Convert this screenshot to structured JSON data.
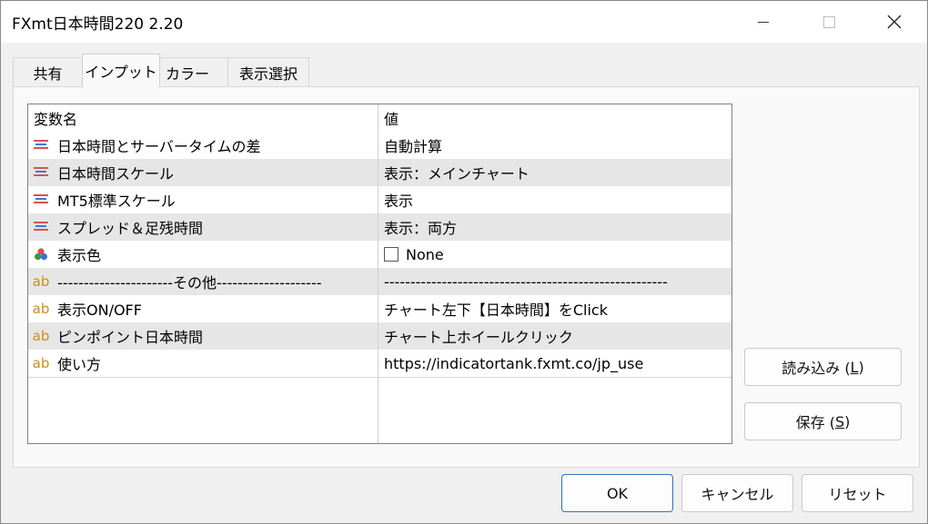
{
  "window": {
    "title": "FXmt日本時間220 2.20"
  },
  "tabs": [
    {
      "label": "共有"
    },
    {
      "label": "インプット"
    },
    {
      "label": "カラー"
    },
    {
      "label": "表示選択"
    }
  ],
  "table": {
    "headers": {
      "name": "変数名",
      "value": "値"
    },
    "rows": [
      {
        "icon": "enum-icon",
        "name": "日本時間とサーバータイムの差",
        "value": "自動計算"
      },
      {
        "icon": "enum-icon",
        "name": "日本時間スケール",
        "value": "表示：メインチャート"
      },
      {
        "icon": "enum-icon",
        "name": "MT5標準スケール",
        "value": "表示"
      },
      {
        "icon": "enum-icon",
        "name": "スプレッド＆足残時間",
        "value": "表示：両方"
      },
      {
        "icon": "color-icon",
        "name": "表示色",
        "value": "None"
      },
      {
        "icon": "string-icon",
        "name": "----------------------その他--------------------",
        "value": "------------------------------------------------------"
      },
      {
        "icon": "string-icon",
        "name": "表示ON/OFF",
        "value": "チャート左下【日本時間】をClick"
      },
      {
        "icon": "string-icon",
        "name": "ピンポイント日本時間",
        "value": "チャート上ホイールクリック"
      },
      {
        "icon": "string-icon",
        "name": "使い方",
        "value": "https://indicatortank.fxmt.co/jp_use"
      }
    ],
    "string_icon_text": "ab"
  },
  "side_buttons": {
    "load_label": "読み込み (",
    "load_key": "L",
    "load_end": ")",
    "save_label": "保存 (",
    "save_key": "S",
    "save_end": ")"
  },
  "footer_buttons": {
    "ok": "OK",
    "cancel": "キャンセル",
    "reset": "リセット"
  }
}
